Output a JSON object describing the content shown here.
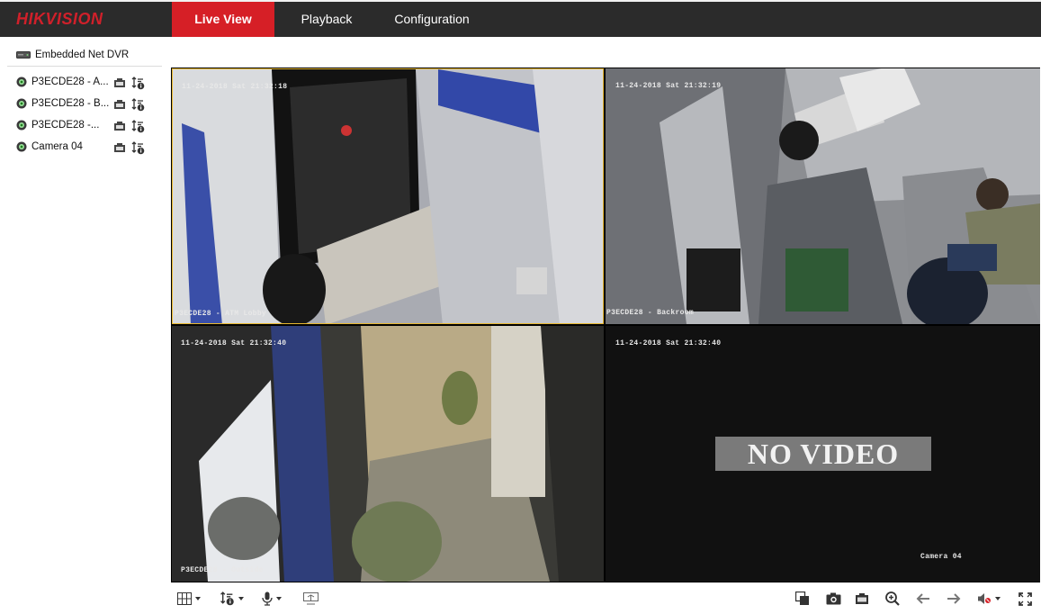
{
  "header": {
    "logo_text": "HIKVISION",
    "tabs": [
      {
        "label": "Live View",
        "active": true
      },
      {
        "label": "Playback",
        "active": false
      },
      {
        "label": "Configuration",
        "active": false
      }
    ]
  },
  "sidebar": {
    "device_label": "Embedded Net DVR",
    "cameras": [
      {
        "label": "P3ECDE28 - A..."
      },
      {
        "label": "P3ECDE28 - B..."
      },
      {
        "label": "P3ECDE28 -..."
      },
      {
        "label": "Camera 04"
      }
    ]
  },
  "video": {
    "tiles": [
      {
        "timestamp": "11-24-2018 Sat 21:32:18",
        "channel_name": "P3ECDE28 - ATM Lobby"
      },
      {
        "timestamp": "11-24-2018 Sat 21:32:19",
        "channel_name": "P3ECDE28 - Backroom"
      },
      {
        "timestamp": "11-24-2018 Sat 21:32:40",
        "channel_name": "P3ECDE28 - Outside"
      },
      {
        "timestamp": "11-24-2018 Sat 21:32:40",
        "channel_name": "Camera 04",
        "status": "NO VIDEO"
      }
    ]
  },
  "colors": {
    "accent": "#d61f26",
    "topbar": "#2b2b2b",
    "selected_border": "#e8b830"
  }
}
